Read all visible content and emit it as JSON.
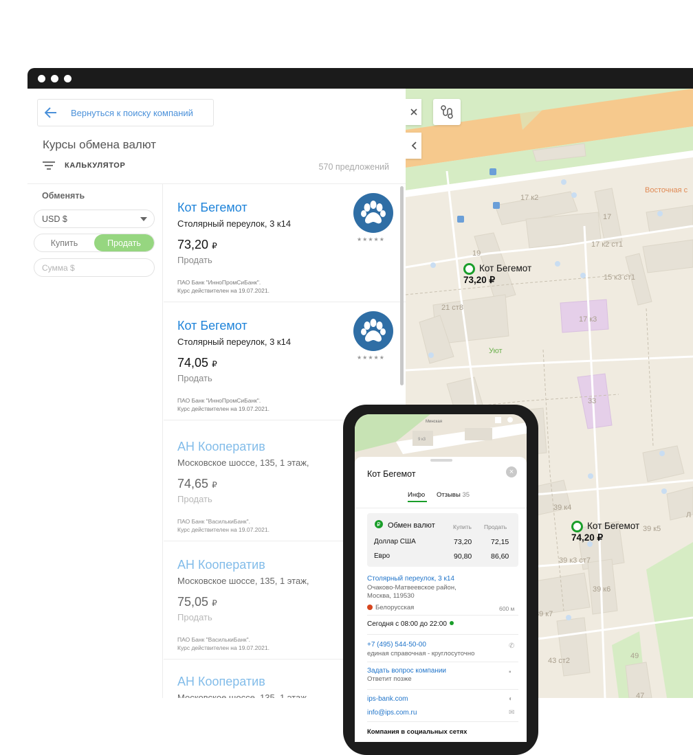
{
  "panel": {
    "back_label": "Вернуться к поиску компаний",
    "title": "Курсы обмена валют",
    "calculator_label": "КАЛЬКУЛЯТОР",
    "offers_count": "570 предложений"
  },
  "filters": {
    "exchange_label": "Обменять",
    "currency_value": "USD $",
    "buy_label": "Купить",
    "sell_label": "Продать",
    "amount_placeholder": "Сумма $"
  },
  "offers": [
    {
      "name": "Кот Бегемот",
      "address": "Столярный переулок, 3 к14",
      "price": "73,20",
      "currency": "₽",
      "mode": "Продать",
      "bank": "ПАО Банк \"ИнноПромСиБанк\".",
      "valid": "Курс действителен на 19.07.2021.",
      "stars": "★★★★★"
    },
    {
      "name": "Кот Бегемот",
      "address": "Столярный переулок, 3 к14",
      "price": "74,05",
      "currency": "₽",
      "mode": "Продать",
      "bank": "ПАО Банк \"ИнноПромСиБанк\".",
      "valid": "Курс действителен на 19.07.2021.",
      "stars": "★★★★★"
    },
    {
      "name": "АН Кооператив",
      "address": "Московское шоссе, 135, 1 этаж,",
      "price": "74,65",
      "currency": "₽",
      "mode": "Продать",
      "bank": "ПАО Банк \"ВасилькиБанк\".",
      "valid": "Курс действителен на 19.07.2021."
    },
    {
      "name": "АН Кооператив",
      "address": "Московское шоссе, 135, 1 этаж,",
      "price": "75,05",
      "currency": "₽",
      "mode": "Продать",
      "bank": "ПАО Банк \"ВасилькиБанк\".",
      "valid": "Курс действителен на 19.07.2021."
    },
    {
      "name": "АН Кооператив",
      "address": "Московское шоссе, 135, 1 этаж,"
    }
  ],
  "map": {
    "labels": [
      "17 к2",
      "17",
      "17 к2 ст1",
      "19",
      "15 к3 ст1",
      "21 ст8",
      "17 к3",
      "Уют",
      "33",
      "Восточная с",
      "39 к4",
      "39 к5",
      "39 к3 ст7",
      "39 к6",
      "39 к7",
      "43 ст2",
      "49",
      "47",
      "Л"
    ],
    "markers": [
      {
        "name": "Кот Бегемот",
        "price": "73,20 ₽"
      },
      {
        "name": "Кот Бегемот",
        "price": "74,20 ₽"
      }
    ],
    "colors": {
      "road": "#f6c98d",
      "park": "#d6ecc4",
      "building": "#e6e1d6",
      "highlight": "#e5cfe9",
      "marker": "#1a9e2a"
    }
  },
  "phone": {
    "map_labels": [
      "Минская",
      "9 к3"
    ],
    "title": "Кот Бегемот",
    "tab_info": "Инфо",
    "tab_reviews": "Отзывы",
    "reviews_count": "35",
    "exchange_title": "Обмен валют",
    "col_buy": "Купить",
    "col_sell": "Продать",
    "rates": [
      {
        "currency": "Доллар США",
        "buy": "73,20",
        "sell": "72,15"
      },
      {
        "currency": "Евро",
        "buy": "90,80",
        "sell": "86,60"
      }
    ],
    "address": "Столярный переулок, 3 к14",
    "district": "Очаково-Матвеевское район,",
    "city": "Москва, 119530",
    "metro": "Белорусская",
    "metro_distance": "600 м",
    "hours": "Сегодня с 08:00 до 22:00",
    "phone": "+7 (495) 544-50-00",
    "phone_note": "единая справочная - круглосуточно",
    "ask": "Задать вопрос компании",
    "ask_note": "Ответит позже",
    "site": "ips-bank.com",
    "email": "info@ips.com.ru",
    "social": "Компания в социальных сетях"
  }
}
